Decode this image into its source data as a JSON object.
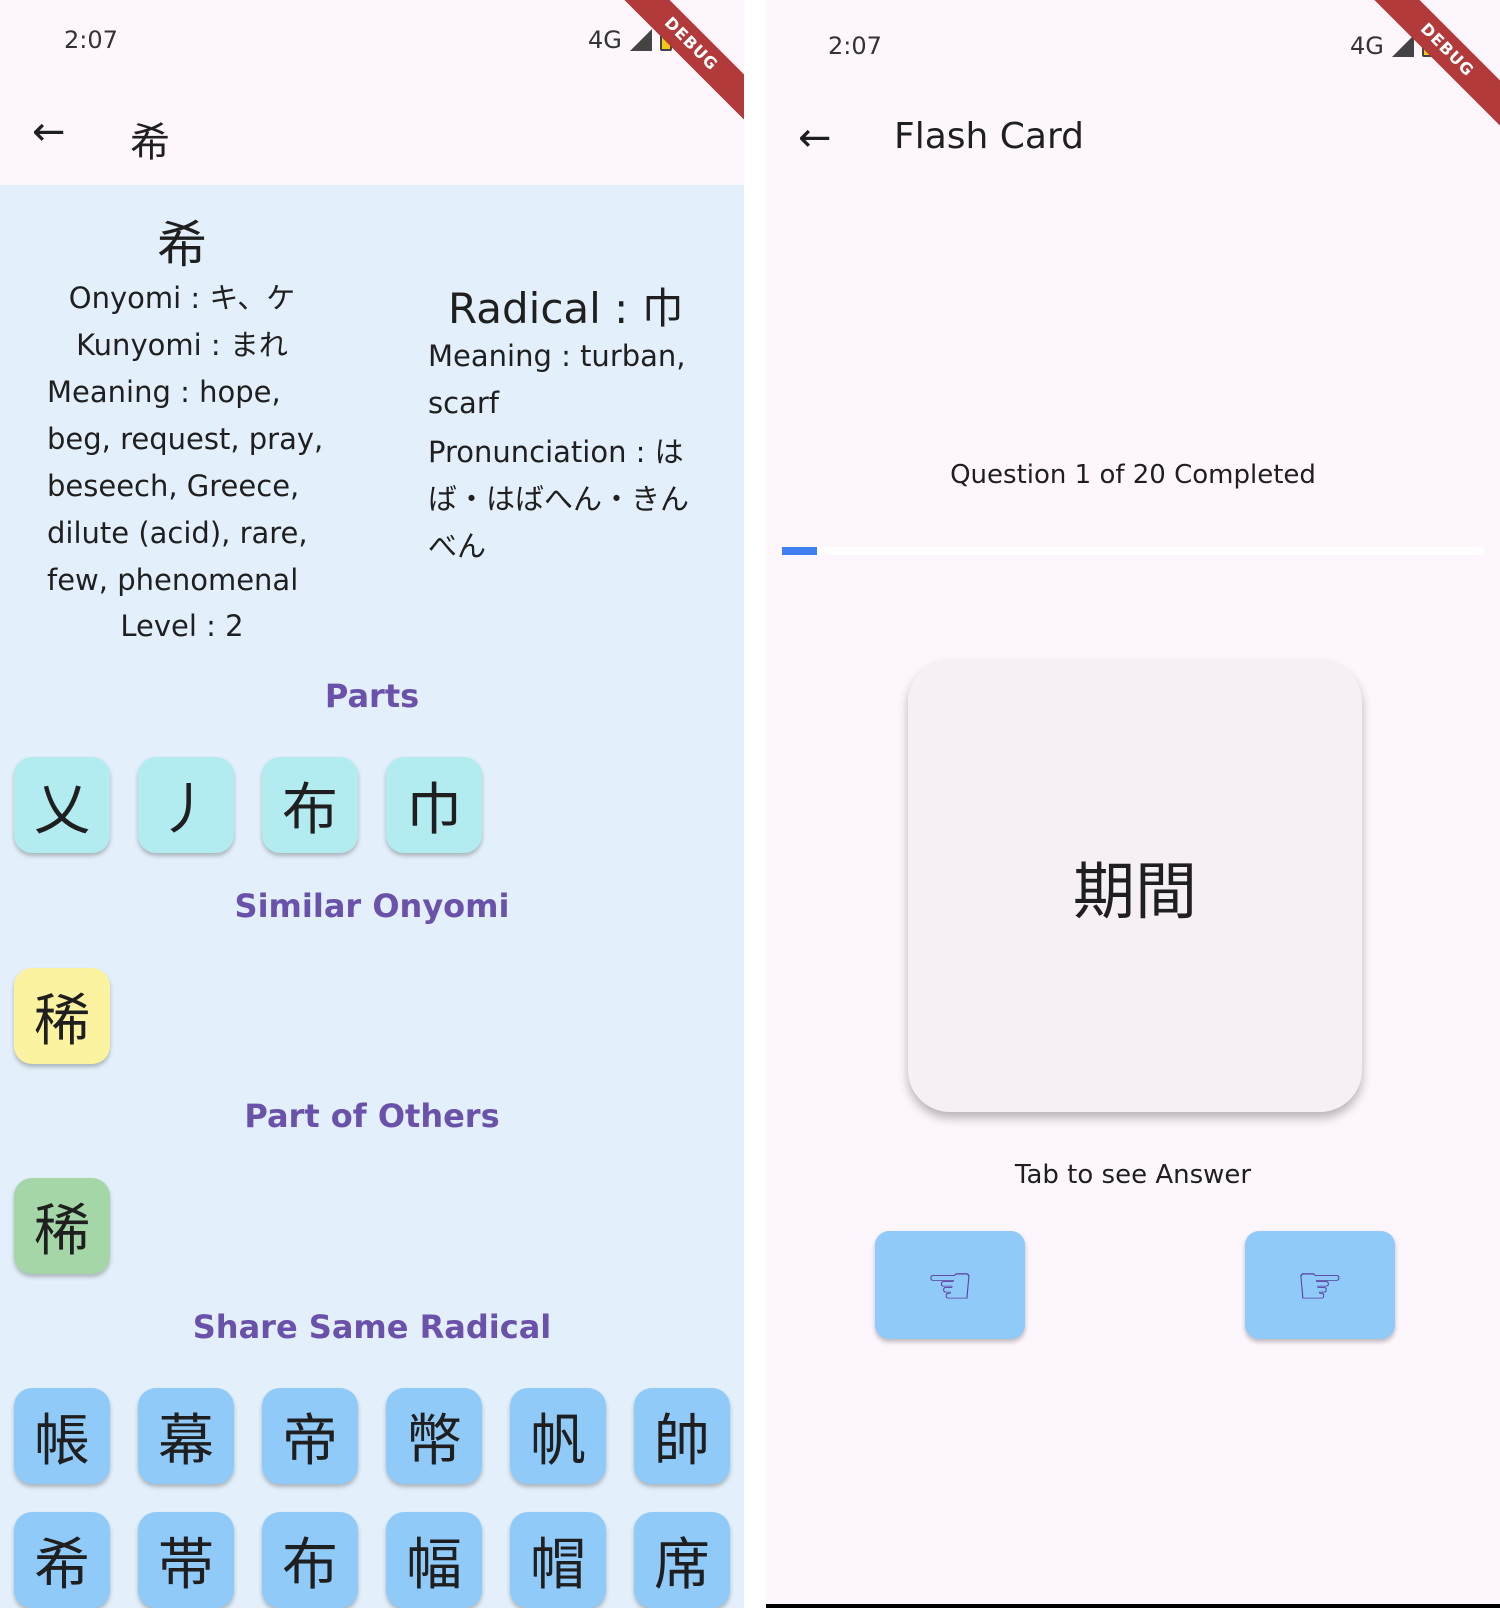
{
  "left": {
    "status": {
      "time": "2:07",
      "network": "4G",
      "debug": "DEBUG"
    },
    "appbar": {
      "title": "希"
    },
    "kanji": "希",
    "onyomi": "Onyomi : キ、ケ",
    "kunyomi": "Kunyomi : まれ",
    "meaning": "Meaning : hope, beg, request, pray, beseech, Greece, dilute (acid), rare, few, phenomenal",
    "level": "Level : 2",
    "radical": {
      "title": "Radical : 巾",
      "meaning": "Meaning : turban, scarf",
      "pronunciation": "Pronunciation : はば・はばへん・きんべん"
    },
    "sections": {
      "parts": "Parts",
      "similar": "Similar Onyomi",
      "partof": "Part of Others",
      "radical": "Share Same Radical"
    },
    "parts": [
      "乂",
      "丿",
      "布",
      "巾"
    ],
    "similar": [
      "稀"
    ],
    "partof": [
      "稀"
    ],
    "radical_row1": [
      "帳",
      "幕",
      "帝",
      "幣",
      "帆",
      "帥"
    ],
    "radical_row2": [
      "希",
      "帯",
      "布",
      "幅",
      "帽",
      "席"
    ],
    "colors": {
      "parts": "#b2ebf0",
      "similar": "#fbf3a0",
      "partof": "#a5d6a7",
      "radical": "#90caf9",
      "section": "#6a51a9"
    }
  },
  "right": {
    "status": {
      "time": "2:07",
      "network": "4G",
      "debug": "DEBUG"
    },
    "appbar": {
      "title": "Flash Card"
    },
    "progress_text": "Question 1 of 20 Completed",
    "progress": 0.05,
    "card": "期間",
    "hint": "Tab to see Answer",
    "buttons": {
      "prev_icon": "hand-pointing-left-icon",
      "next_icon": "hand-pointing-right-icon"
    },
    "colors": {
      "progress": "#3f7ff2",
      "button": "#90caf9",
      "icon": "#5a3fa0"
    }
  }
}
